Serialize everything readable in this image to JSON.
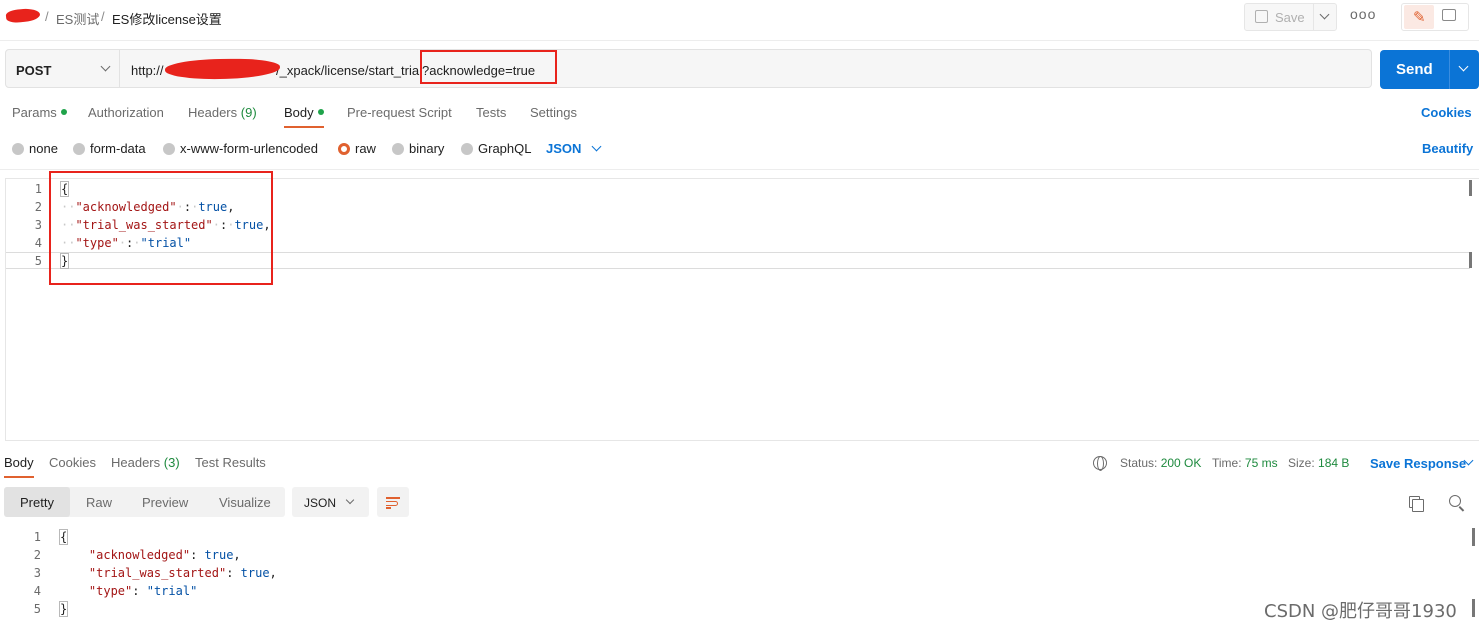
{
  "breadcrumb": {
    "separator": "/",
    "collection": "ES测试",
    "request_name": "ES修改license设置"
  },
  "toolbar": {
    "save_label": "Save",
    "more_label": "ooo"
  },
  "request": {
    "method": "POST",
    "url_prefix": "http://",
    "url_path": "/_xpack/license/start_trial",
    "url_query": "?acknowledge=true",
    "send_label": "Send"
  },
  "request_tabs": {
    "params": "Params",
    "authorization": "Authorization",
    "headers": "Headers",
    "headers_count": "(9)",
    "body": "Body",
    "pre_request": "Pre-request Script",
    "tests": "Tests",
    "settings": "Settings",
    "cookies": "Cookies"
  },
  "body_types": {
    "none": "none",
    "form_data": "form-data",
    "urlencoded": "x-www-form-urlencoded",
    "raw": "raw",
    "binary": "binary",
    "graphql": "GraphQL",
    "language": "JSON",
    "selected": "raw",
    "beautify": "Beautify"
  },
  "request_body": {
    "line_numbers": [
      "1",
      "2",
      "3",
      "4",
      "5"
    ],
    "open_brace": "{",
    "close_brace": "}",
    "key1": "\"acknowledged\"",
    "val1": "true",
    "key2": "\"trial_was_started\"",
    "val2": "true",
    "key3": "\"type\"",
    "val3": "\"trial\""
  },
  "response_tabs": {
    "body": "Body",
    "cookies": "Cookies",
    "headers": "Headers",
    "headers_count": "(3)",
    "test_results": "Test Results"
  },
  "response_status": {
    "status_label": "Status:",
    "status_value": "200 OK",
    "time_label": "Time:",
    "time_value": "75 ms",
    "size_label": "Size:",
    "size_value": "184 B",
    "save_response": "Save Response"
  },
  "response_view": {
    "pretty": "Pretty",
    "raw": "Raw",
    "preview": "Preview",
    "visualize": "Visualize",
    "format": "JSON"
  },
  "response_body": {
    "line_numbers": [
      "1",
      "2",
      "3",
      "4",
      "5"
    ],
    "open_brace": "{",
    "close_brace": "}",
    "key1": "\"acknowledged\"",
    "val1": "true",
    "key2": "\"trial_was_started\"",
    "val2": "true",
    "key3": "\"type\"",
    "val3": "\"trial\""
  },
  "watermark": "CSDN @肥仔哥哥1930",
  "colors": {
    "accent_orange": "#e0612f",
    "send_blue": "#0b74d6",
    "status_green": "#1e8a3e",
    "annotation_red": "#e8231c"
  }
}
